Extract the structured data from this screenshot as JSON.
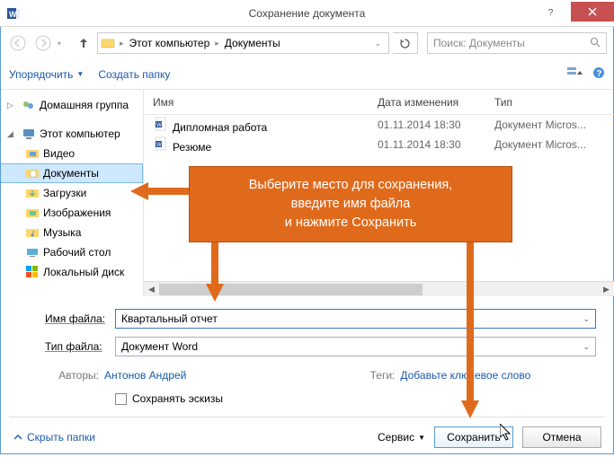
{
  "window": {
    "title": "Сохранение документа"
  },
  "nav": {
    "crumb1": "Этот компьютер",
    "crumb2": "Документы",
    "search_placeholder": "Поиск: Документы"
  },
  "toolbar": {
    "organize": "Упорядочить",
    "new_folder": "Создать папку"
  },
  "sidebar": {
    "homegroup": "Домашняя группа",
    "this_pc": "Этот компьютер",
    "items": [
      {
        "label": "Видео"
      },
      {
        "label": "Документы"
      },
      {
        "label": "Загрузки"
      },
      {
        "label": "Изображения"
      },
      {
        "label": "Музыка"
      },
      {
        "label": "Рабочий стол"
      },
      {
        "label": "Локальный диск"
      }
    ]
  },
  "filelist": {
    "headers": {
      "name": "Имя",
      "date": "Дата изменения",
      "type": "Тип"
    },
    "rows": [
      {
        "name": "Дипломная работа",
        "date": "01.11.2014 18:30",
        "type": "Документ Micros..."
      },
      {
        "name": "Резюме",
        "date": "01.11.2014 18:30",
        "type": "Документ Micros..."
      }
    ]
  },
  "callout": {
    "line1": "Выберите место для сохранения,",
    "line2": "введите имя файла",
    "line3": "и нажмите Сохранить"
  },
  "fields": {
    "filename_label": "Имя файла:",
    "filename_value": "Квартальный отчет",
    "filetype_label": "Тип файла:",
    "filetype_value": "Документ Word",
    "authors_label": "Авторы:",
    "authors_value": "Антонов Андрей",
    "tags_label": "Теги:",
    "tags_value": "Добавьте ключевое слово",
    "save_thumb": "Сохранять эскизы"
  },
  "footer": {
    "hide_folders": "Скрыть папки",
    "service": "Сервис",
    "save": "Сохранить",
    "cancel": "Отмена"
  }
}
